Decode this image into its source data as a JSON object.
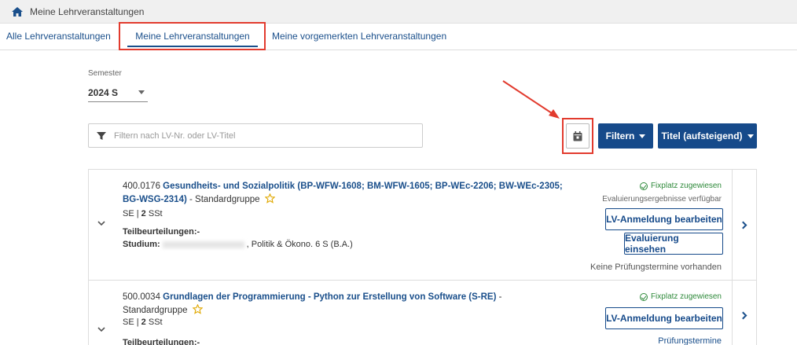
{
  "breadcrumb": {
    "title": "Meine Lehrveranstaltungen",
    "icon": "home-icon"
  },
  "tabs": [
    {
      "label": "Alle Lehrveranstaltungen",
      "active": false
    },
    {
      "label": "Meine Lehrveranstaltungen",
      "active": true
    },
    {
      "label": "Meine vorgemerkten Lehrveranstaltungen",
      "active": false
    }
  ],
  "semester": {
    "label": "Semester",
    "value": "2024 S"
  },
  "filter": {
    "placeholder": "Filtern nach LV-Nr. oder LV-Titel"
  },
  "toolbar": {
    "filter_label": "Filtern",
    "sort_label": "Titel (aufsteigend)"
  },
  "courses": [
    {
      "number": "400.0176",
      "title": "Gesundheits- und Sozialpolitik (BP-WFW-1608; BM-WFW-1605; BP-WEc-2206; BW-WEc-2305; BG-WSG-2314)",
      "group": "- Standardgruppe",
      "type": "SE",
      "sst_value": "2",
      "sst_unit": "SSt",
      "teil_label": "Teilbeurteilungen:-",
      "studium_label": "Studium:",
      "studium_value": ", Politik & Ökono. 6 S (B.A.)",
      "status": "Fixplatz zugewiesen",
      "eval_note": "Evaluierungsergebnisse verfügbar",
      "btn_edit": "LV-Anmeldung bearbeiten",
      "btn_eval": "Evaluierung einsehen",
      "exam_note": "Keine Prüfungstermine vorhanden"
    },
    {
      "number": "500.0034",
      "title": "Grundlagen der Programmierung - Python zur Erstellung von Software (S-RE)",
      "group_line1": "-",
      "group_line2": "Standardgruppe",
      "type": "SE",
      "sst_value": "2",
      "sst_unit": "SSt",
      "teil_label": "Teilbeurteilungen:-",
      "status": "Fixplatz zugewiesen",
      "btn_edit": "LV-Anmeldung bearbeiten",
      "exam_link": "Prüfungstermine"
    }
  ],
  "colors": {
    "accent": "#164a8a",
    "annotation": "#e23b2e",
    "status": "#2f8a3b"
  }
}
